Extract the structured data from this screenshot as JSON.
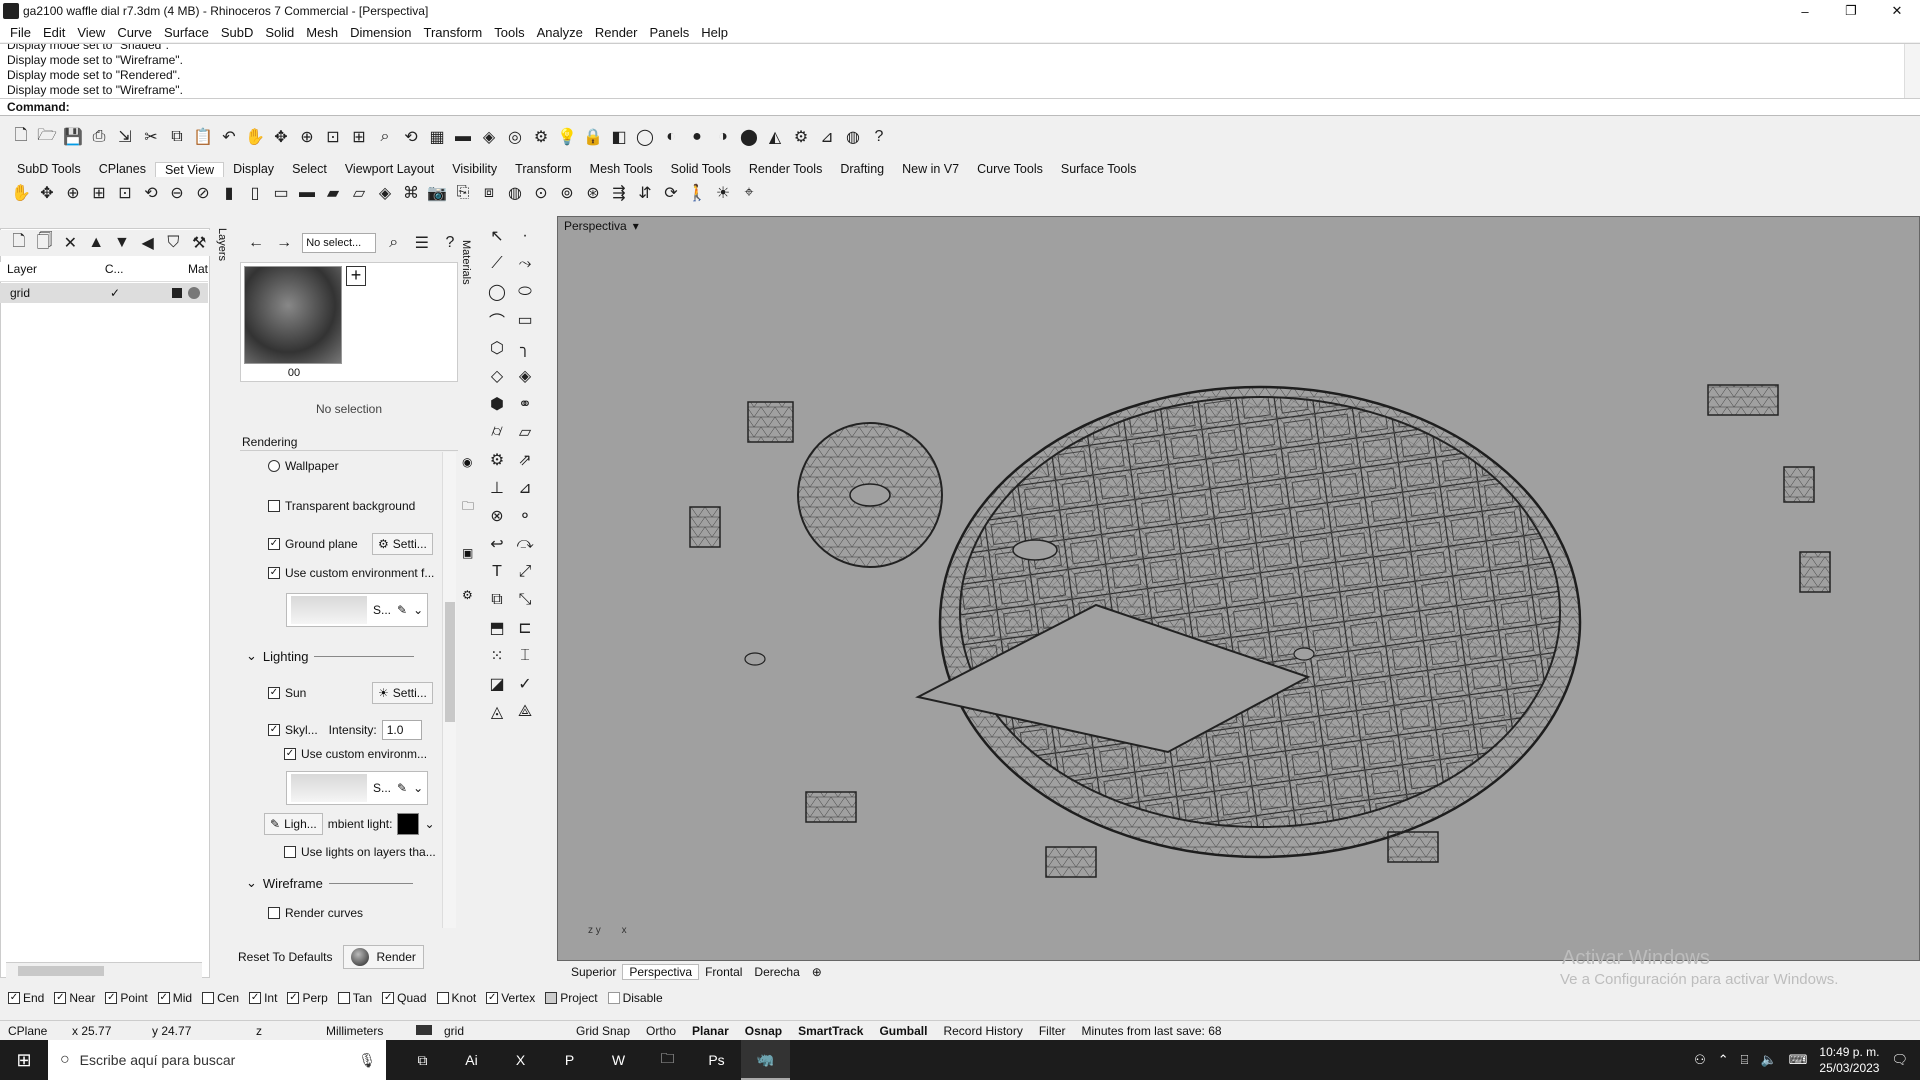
{
  "window": {
    "title": "ga2100 waffle dial r7.3dm (4 MB) - Rhinoceros 7 Commercial - [Perspectiva]",
    "minimize": "–",
    "restore": "❐",
    "close": "✕"
  },
  "menu": [
    "File",
    "Edit",
    "View",
    "Curve",
    "Surface",
    "SubD",
    "Solid",
    "Mesh",
    "Dimension",
    "Transform",
    "Tools",
    "Analyze",
    "Render",
    "Panels",
    "Help"
  ],
  "command_history": [
    "Display mode set to \"Shaded\".",
    "Display mode set to \"Wireframe\".",
    "Display mode set to \"Rendered\".",
    "Display mode set to \"Wireframe\"."
  ],
  "command_prompt": "Command:",
  "toolbar_tabs": [
    "SubD Tools",
    "CPlanes",
    "Set View",
    "Display",
    "Select",
    "Viewport Layout",
    "Visibility",
    "Transform",
    "Mesh Tools",
    "Solid Tools",
    "Render Tools",
    "Drafting",
    "New in V7",
    "Curve Tools",
    "Surface Tools"
  ],
  "active_toolbar_tab": "Set View",
  "layers": {
    "columns": [
      "Layer",
      "C...",
      "Mat"
    ],
    "rows": [
      {
        "name": "grid",
        "current": "✓"
      }
    ],
    "side_tab": "Layers"
  },
  "materials": {
    "search_placeholder": "No select...",
    "thumb_caption": "00",
    "no_selection": "No selection",
    "side_tab": "Materials"
  },
  "rendering": {
    "header": "Rendering",
    "wallpaper": "Wallpaper",
    "transparent_background": "Transparent background",
    "ground_plane": "Ground plane",
    "ground_settings": "Setti...",
    "use_custom_env": "Use custom environment f...",
    "env_short": "S...",
    "lighting": "Lighting",
    "sun": "Sun",
    "sun_settings": "Setti...",
    "skylight": "Skyl...",
    "intensity_label": "Intensity:",
    "intensity_value": "1.0",
    "use_custom_env2": "Use custom environm...",
    "env_short2": "S...",
    "light_button": "Ligh...",
    "ambient_light": "mbient light:",
    "ambient_color": "#000000",
    "use_lights_layers": "Use lights on layers tha...",
    "wireframe": "Wireframe",
    "render_curves": "Render curves",
    "reset_defaults": "Reset To Defaults",
    "render": "Render"
  },
  "viewport": {
    "title": "Perspectiva",
    "axes_y": "y",
    "axes_z": "z",
    "axes_x": "x",
    "tabs": [
      "Superior",
      "Perspectiva",
      "Frontal",
      "Derecha"
    ],
    "active_tab": "Perspectiva",
    "watermark_line1": "Activar Windows",
    "watermark_line2": "Ve a Configuración para activar Windows."
  },
  "osnap": [
    {
      "label": "End",
      "checked": true
    },
    {
      "label": "Near",
      "checked": true
    },
    {
      "label": "Point",
      "checked": true
    },
    {
      "label": "Mid",
      "checked": true
    },
    {
      "label": "Cen",
      "checked": false
    },
    {
      "label": "Int",
      "checked": true
    },
    {
      "label": "Perp",
      "checked": true
    },
    {
      "label": "Tan",
      "checked": false
    },
    {
      "label": "Quad",
      "checked": true
    },
    {
      "label": "Knot",
      "checked": false
    },
    {
      "label": "Vertex",
      "checked": true
    },
    {
      "label": "Project",
      "checked": false
    },
    {
      "label": "Disable",
      "checked": false
    }
  ],
  "status": {
    "cplane": "CPlane",
    "x": "x 25.77",
    "y": "y 24.77",
    "z": "z",
    "units": "Millimeters",
    "layer": "grid",
    "grid_snap": "Grid Snap",
    "ortho": "Ortho",
    "planar": "Planar",
    "osnap": "Osnap",
    "smarttrack": "SmartTrack",
    "gumball": "Gumball",
    "record_history": "Record History",
    "filter": "Filter",
    "save_info": "Minutes from last save: 68"
  },
  "taskbar": {
    "search_placeholder": "Escribe aquí para buscar",
    "time": "10:49 p. m.",
    "date": "25/03/2023"
  }
}
